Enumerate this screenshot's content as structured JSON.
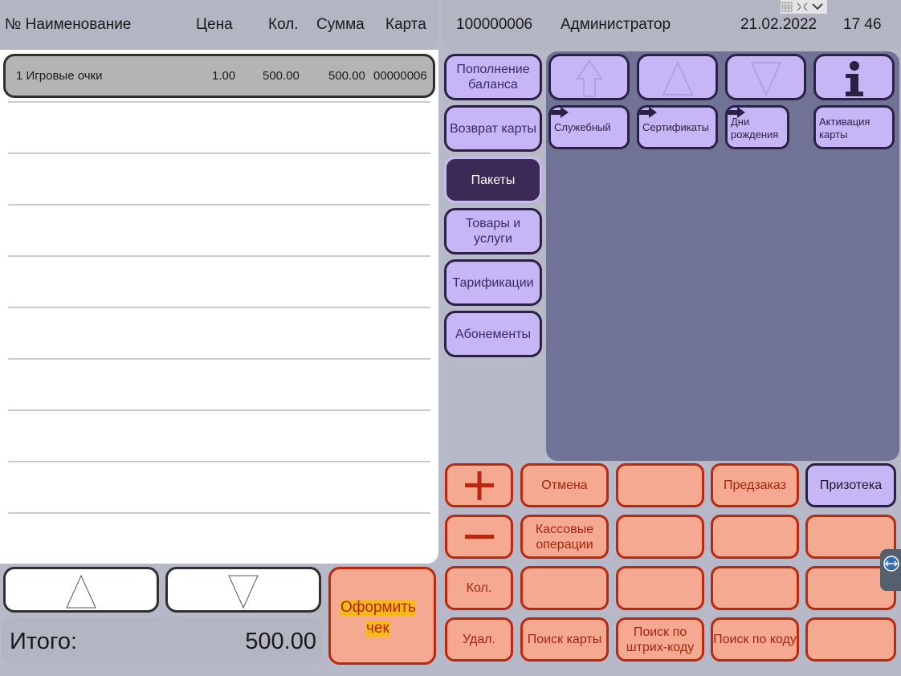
{
  "receipt": {
    "columns": {
      "name": "№ Наименование",
      "price": "Цена",
      "qty": "Кол.",
      "sum": "Сумма",
      "card": "Карта"
    },
    "rows": [
      {
        "index_name": "1 Игровые очки",
        "price": "1.00",
        "qty": "500.00",
        "sum": "500.00",
        "card": "00000006"
      }
    ],
    "total_label": "Итого:",
    "total_value": "500.00",
    "checkout_line1": "Оформить",
    "checkout_line2": "чек"
  },
  "header": {
    "terminal": "100000006",
    "user": "Администратор",
    "date": "21.02.2022",
    "time": "17 46"
  },
  "categories": [
    {
      "label": "Пополнение баланса",
      "active": false
    },
    {
      "label": "Возврат карты",
      "active": false
    },
    {
      "label": "Пакеты",
      "active": true
    },
    {
      "label": "Товары и услуги",
      "active": false
    },
    {
      "label": "Тарификации",
      "active": false
    },
    {
      "label": "Абонементы",
      "active": false
    }
  ],
  "tiles": {
    "nav": [
      "up-home-icon",
      "up-icon",
      "down-icon",
      "info-icon"
    ],
    "items": [
      {
        "label": "Служебный"
      },
      {
        "label": "Сертификаты"
      },
      {
        "label": "Дни рождения"
      },
      {
        "label": "Активация карты"
      }
    ]
  },
  "keypad": {
    "plus_icon": "plus-icon",
    "minus_icon": "minus-icon",
    "qty": "Кол.",
    "delete": "Удал.",
    "cancel": "Отмена",
    "cash_ops": "Кассовые операции",
    "search_card": "Поиск карты",
    "preorder": "Предзаказ",
    "search_barcode": "Поиск по штрих-коду",
    "prizes": "Призотека",
    "search_code": "Поиск по коду"
  },
  "colors": {
    "accent_purple": "#c6b6f6",
    "active_purple": "#3a2a55",
    "panel_slate": "#717396",
    "action_salmon": "#f4a990",
    "action_border": "#b8290f",
    "highlight": "#f7b81a"
  }
}
